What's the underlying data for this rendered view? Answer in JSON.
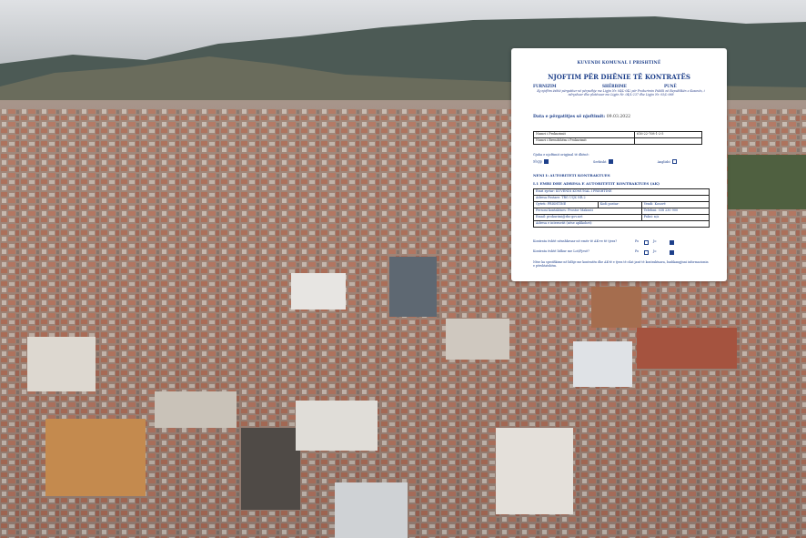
{
  "photo": {
    "description_icon": "aerial-city-photo"
  },
  "document": {
    "ministry": "KUVENDI KOMUNAL I PRISHTINË",
    "title": "NJOFTIM PËR DHËNIE TË KONTRATËS",
    "categories": [
      "FURNIZIM",
      "SHËRBIME",
      "PUNË"
    ],
    "note": "Ky njoftim është përgatitur në përputhje me Ligjin Nr. 04/L-042 për Prokurimin Publik në Republikën e Kosovës, i ndryshuar dhe plotësuar me Ligjin Nr. 04/L-237 dhe Ligjin Nr. 05/L-068",
    "date_label": "Data e përgatitjes së njoftimit:",
    "date_value": "09.03.2022",
    "procurement_table": [
      [
        "Numri i Prokurimit",
        "616-22-708-1-2-5"
      ],
      [
        "Numri i Brendshëm i Prokurimit",
        ""
      ]
    ],
    "language_label": "Gjuha e njoftimit origjinal të dhënë:",
    "languages": [
      {
        "label": "Shqip",
        "checked": true
      },
      {
        "label": "Serbisht",
        "checked": true
      },
      {
        "label": "Anglisht",
        "checked": false
      }
    ],
    "section1": "NENI I: AUTORITETI KONTRAKTUES",
    "section1_1": "I.1 EMRI DHE ADRESA E AUTORITETIT KONTRAKTUES (AK)",
    "ak_table": [
      [
        "Emri zyrtar: KUVENDI KOMUNAL I PRISHTINË",
        ""
      ],
      [
        "Adresa Postare: TRG UÇK NR.2",
        ""
      ],
      [
        "Qyteti: PRISHTINË",
        "Kodi postar:",
        "Vendi: Kosovë"
      ],
      [
        "Personi kontaktues: Prostor Maksuti",
        "Telefoni: 038 230 900"
      ],
      [
        "Email: prokurimi@rks-gov.net",
        "Faksi: n/a"
      ],
      [
        "Adresa e internetit (nëse aplikohet):",
        ""
      ]
    ],
    "q1": "Kontrata është nënshkruar në emër të AK-ve të tjera?",
    "q2": "Kontrata është lidhur me Lot/Pjesë?",
    "yes": "Po",
    "no": "Jo",
    "paragraph": "Nëse ka specifikime në lidhje me kontratën dhe AK-të e tjera të cilat janë të kontraktuara, bashkangjisni informacionin e përshtatshëm."
  }
}
